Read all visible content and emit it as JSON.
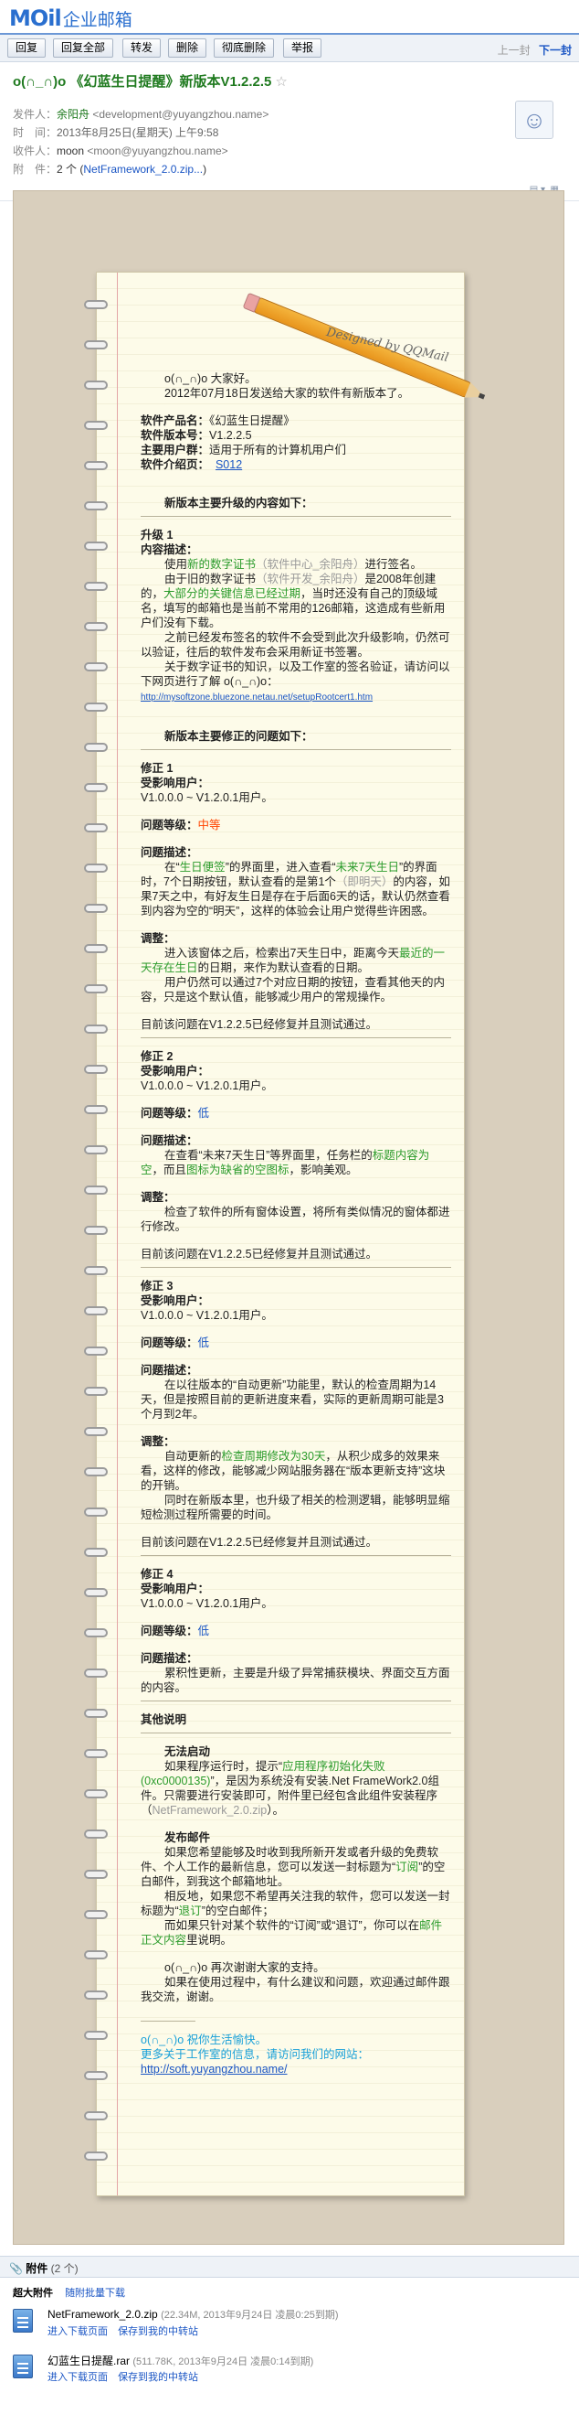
{
  "app": {
    "logo": "MOil",
    "logo_cn": "企业邮箱"
  },
  "toolbar": {
    "reply": "回复",
    "reply_all": "回复全部",
    "forward": "转发",
    "delete": "删除",
    "delete_forever": "彻底删除",
    "report": "举报",
    "prev": "上一封",
    "next": "下一封"
  },
  "mail": {
    "subject": "o(∩_∩)o 《幻蓝生日提醒》新版本V1.2.2.5",
    "star": "☆",
    "sender_label": "发件人：",
    "sender_name": "余阳舟",
    "sender_addr": "<development@yuyangzhou.name>",
    "time_label": "时　间：",
    "time": "2013年8月25日(星期天) 上午9:58",
    "to_label": "收件人：",
    "to_name": "moon",
    "to_addr": "<moon@yuyangzhou.name>",
    "attach_label": "附　件：",
    "attach_count": "2 个",
    "attach_first": "NetFramework_2.0.zip..."
  },
  "letter": {
    "designed_by": "Designed by QQMail",
    "greeting": "o(∩_∩)o  大家好。",
    "intro": "2012年07月18日发送给大家的软件有新版本了。",
    "name_label": "软件产品名：",
    "name_value": "《幻蓝生日提醒》",
    "ver_label": "软件版本号：",
    "ver_value": "V1.2.2.5",
    "users_label": "主要用户群：",
    "users_value": "适用于所有的计算机用户们",
    "intro_page_label": "软件介绍页：",
    "intro_page_value": "S012",
    "upgrade_title": "新版本主要升级的内容如下：",
    "up1_title": "升级 1",
    "up1_desc_label": "内容描述：",
    "up1_p1_a": "使用",
    "up1_p1_b": "新的数字证书",
    "up1_p1_c": "（软件中心_余阳舟）",
    "up1_p1_d": "进行签名。",
    "up1_p2_a": "由于旧的数字证书",
    "up1_p2_b": "（软件开发_余阳舟）",
    "up1_p2_c": "是2008年创建的，",
    "up1_p2_d": "大部分的关键信息已经过期",
    "up1_p2_e": "，当时还没有自己的顶级域名，填写的邮箱也是当前不常用的126邮箱，这造成有些新用户们没有下载。",
    "up1_p3": "之前已经发布签名的软件不会受到此次升级影响，仍然可以验证，往后的软件发布会采用新证书签署。",
    "up1_p4": "关于数字证书的知识，以及工作室的签名验证，请访问以下网页进行了解 o(∩_∩)o：",
    "up1_link": "http://mysoftzone.bluezone.netau.net/setupRootcert1.htm",
    "fix_title": "新版本主要修正的问题如下：",
    "fix1_title": "修正 1",
    "affected_label": "受影响用户：",
    "affected_range": "V1.0.0.0 ~ V1.2.0.1用户。",
    "level_label": "问题等级：",
    "fix1_level": "中等",
    "desc_label": "问题描述：",
    "fix1_desc_a": "在“",
    "fix1_desc_b": "生日便签",
    "fix1_desc_c": "”的界面里，进入查看“",
    "fix1_desc_d": "未来7天生日",
    "fix1_desc_e": "”的界面时，7个日期按钮，默认查看的是第1个",
    "fix1_desc_f": "（即明天）",
    "fix1_desc_g": "的内容，如果7天之中，有好友生日是存在于后面6天的话，默认仍然查看到内容为空的“明天”，这样的体验会让用户觉得些许困惑。",
    "adjust_label": "调整：",
    "fix1_adj_a": "进入该窗体之后，检索出7天生日中，距离今天",
    "fix1_adj_b": "最近的一天存在生日",
    "fix1_adj_c": "的日期，来作为默认查看的日期。",
    "fix1_adj_p2": "用户仍然可以通过7个对应日期的按钮，查看其他天的内容，只是这个默认值，能够减少用户的常规操作。",
    "fixed_note": "目前该问题在V1.2.2.5已经修复并且测试通过。",
    "fix2_title": "修正 2",
    "low": "低",
    "fix2_desc_a": "在查看“未来7天生日”等界面里，任务栏的",
    "fix2_desc_b": "标题内容为空",
    "fix2_desc_c": "，而且",
    "fix2_desc_d": "图标为缺省的空图标",
    "fix2_desc_e": "，影响美观。",
    "fix2_adj": "检查了软件的所有窗体设置，将所有类似情况的窗体都进行修改。",
    "fix3_title": "修正 3",
    "fix3_desc": "在以往版本的“自动更新”功能里，默认的检查周期为14天，但是按照目前的更新进度来看，实际的更新周期可能是3个月到2年。",
    "fix3_adj_a": "自动更新的",
    "fix3_adj_b": "检查周期修改为30天",
    "fix3_adj_c": "，从积少成多的效果来看，这样的修改，能够减少网站服务器在“版本更新支持”这块的开销。",
    "fix3_adj_p2": "同时在新版本里，也升级了相关的检测逻辑，能够明显缩短检测过程所需要的时间。",
    "fix4_title": "修正 4",
    "fix4_desc": "累积性更新，主要是升级了异常捕获模块、界面交互方面的内容。",
    "other_title": "其他说明",
    "cannot_start": "无法启动",
    "cs_a": "如果程序运行时，提示“",
    "cs_b": "应用程序初始化失败(0xc0000135)",
    "cs_c": "”，是因为系统没有安装.Net FrameWork2.0组件。只需要进行安装即可，附件里已经包含此组件安装程序（",
    "cs_d": "NetFramework_2.0.zip",
    "cs_e": "）。",
    "publish_title": "发布邮件",
    "pub_p1_a": "如果您希望能够及时收到我所新开发或者升级的免费软件、个人工作的最新信息，您可以发送一封标题为“",
    "pub_p1_b": "订阅",
    "pub_p1_c": "”的空白邮件，到我这个邮箱地址。",
    "pub_p2_a": "相反地，如果您不希望再关注我的软件，您可以发送一封标题为“",
    "pub_p2_b": "退订",
    "pub_p2_c": "”的空白邮件；",
    "pub_p3_a": "而如果只针对某个软件的“订阅”或“退订”，你可以在",
    "pub_p3_b": "邮件正文内容",
    "pub_p3_c": "里说明。",
    "thanks": "o(∩_∩)o 再次谢谢大家的支持。",
    "thanks_p2": "如果在使用过程中，有什么建议和问题，欢迎通过邮件跟我交流，谢谢。",
    "sign1": "o(∩_∩)o  祝你生活愉快。",
    "sign2": "更多关于工作室的信息，请访问我们的网站：",
    "sign_link": "http://soft.yuyangzhou.name/"
  },
  "attachments": {
    "header": "附件",
    "count": "(2 个)",
    "super_label": "超大附件",
    "batch_download": "随附批量下载",
    "files": [
      {
        "name": "NetFramework_2.0.zip",
        "meta": "(22.34M, 2013年9月24日 凌晨0:25到期)",
        "action1": "进入下载页面",
        "action2": "保存到我的中转站"
      },
      {
        "name": "幻蓝生日提醒.rar",
        "meta": "(511.78K, 2013年9月24日 凌晨0:14到期)",
        "action1": "进入下载页面",
        "action2": "保存到我的中转站"
      }
    ]
  },
  "icons": {
    "avatar": "user-avatar-icon",
    "file": "file-icon",
    "pencil": "pencil-icon"
  }
}
